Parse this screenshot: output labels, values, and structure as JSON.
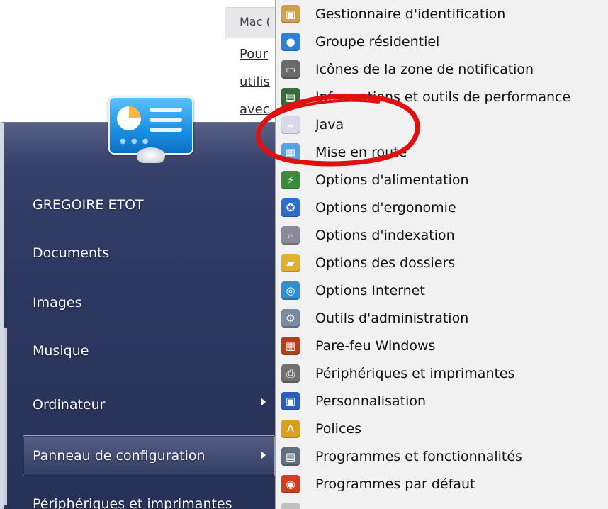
{
  "background_window": {
    "header": "Mac (",
    "links": [
      "Pour",
      "utilis",
      "avec"
    ]
  },
  "start_menu": {
    "user_name": "GREGOIRE ETOT",
    "items": [
      {
        "label": "Documents",
        "has_submenu": false
      },
      {
        "label": "Images",
        "has_submenu": false
      },
      {
        "label": "Musique",
        "has_submenu": false
      },
      {
        "label": "Ordinateur",
        "has_submenu": true
      },
      {
        "label": "Panneau de configuration",
        "has_submenu": true,
        "selected": true
      },
      {
        "label": "Périphériques et imprimantes",
        "has_submenu": false
      }
    ]
  },
  "control_panel_menu": {
    "items": [
      {
        "label": "Gestionnaire d'identification",
        "icon": "vault-icon",
        "glyph": "▣",
        "color": "#c9a24a"
      },
      {
        "label": "Groupe résidentiel",
        "icon": "homegroup-icon",
        "glyph": "●",
        "color": "#2f7fd6"
      },
      {
        "label": "Icônes de la zone de notification",
        "icon": "notification-area-icon",
        "glyph": "▭",
        "color": "#6a6a6a"
      },
      {
        "label": "Informations et outils de performance",
        "icon": "performance-icon",
        "glyph": "▤",
        "color": "#3a6a3a"
      },
      {
        "label": "Java",
        "icon": "java-icon",
        "glyph": "☕",
        "color": "#d8d8e8"
      },
      {
        "label": "Mise en route",
        "icon": "getting-started-icon",
        "glyph": "▦",
        "color": "#5aa0e0"
      },
      {
        "label": "Options d'alimentation",
        "icon": "power-options-icon",
        "glyph": "⚡",
        "color": "#3c8a3c"
      },
      {
        "label": "Options d'ergonomie",
        "icon": "ease-of-access-icon",
        "glyph": "✪",
        "color": "#2b6fc9"
      },
      {
        "label": "Options d'indexation",
        "icon": "indexing-icon",
        "glyph": "⌕",
        "color": "#8a8a9a"
      },
      {
        "label": "Options des dossiers",
        "icon": "folder-options-icon",
        "glyph": "▰",
        "color": "#e0b030"
      },
      {
        "label": "Options Internet",
        "icon": "internet-options-icon",
        "glyph": "◎",
        "color": "#2f8fd0"
      },
      {
        "label": "Outils d'administration",
        "icon": "admin-tools-icon",
        "glyph": "⚙",
        "color": "#7a8aa0"
      },
      {
        "label": "Pare-feu Windows",
        "icon": "firewall-icon",
        "glyph": "▦",
        "color": "#b04020"
      },
      {
        "label": "Périphériques et imprimantes",
        "icon": "printer-icon",
        "glyph": "⎙",
        "color": "#707070"
      },
      {
        "label": "Personnalisation",
        "icon": "personalization-icon",
        "glyph": "▣",
        "color": "#2a5fb8"
      },
      {
        "label": "Polices",
        "icon": "fonts-icon",
        "glyph": "A",
        "color": "#d8a020"
      },
      {
        "label": "Programmes et fonctionnalités",
        "icon": "programs-features-icon",
        "glyph": "▤",
        "color": "#607080"
      },
      {
        "label": "Programmes par défaut",
        "icon": "default-programs-icon",
        "glyph": "◉",
        "color": "#d04020"
      },
      {
        "label": "",
        "icon": "next-item-icon",
        "glyph": "",
        "color": "#c0c0c0"
      }
    ]
  },
  "annotation": {
    "color": "#e01010",
    "target": "Java"
  }
}
